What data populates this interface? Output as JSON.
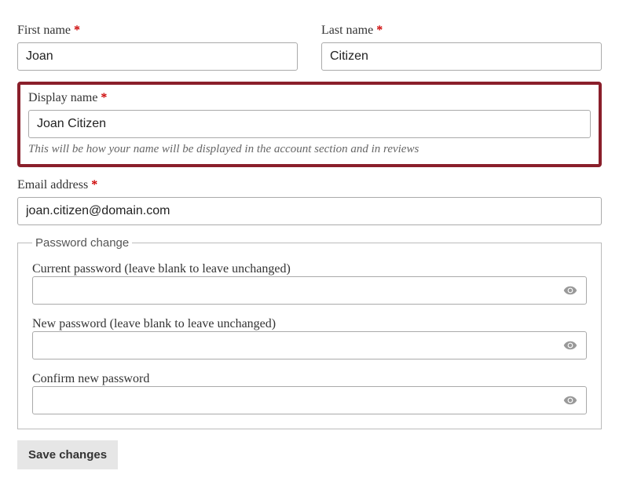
{
  "first_name": {
    "label": "First name",
    "value": "Joan"
  },
  "last_name": {
    "label": "Last name",
    "value": "Citizen"
  },
  "display_name": {
    "label": "Display name",
    "value": "Joan Citizen",
    "hint": "This will be how your name will be displayed in the account section and in reviews"
  },
  "email": {
    "label": "Email address",
    "value": "joan.citizen@domain.com"
  },
  "password_section": {
    "legend": "Password change",
    "current": {
      "label": "Current password (leave blank to leave unchanged)",
      "value": ""
    },
    "new": {
      "label": "New password (leave blank to leave unchanged)",
      "value": ""
    },
    "confirm": {
      "label": "Confirm new password",
      "value": ""
    }
  },
  "save_label": "Save changes",
  "required_marker": "*"
}
